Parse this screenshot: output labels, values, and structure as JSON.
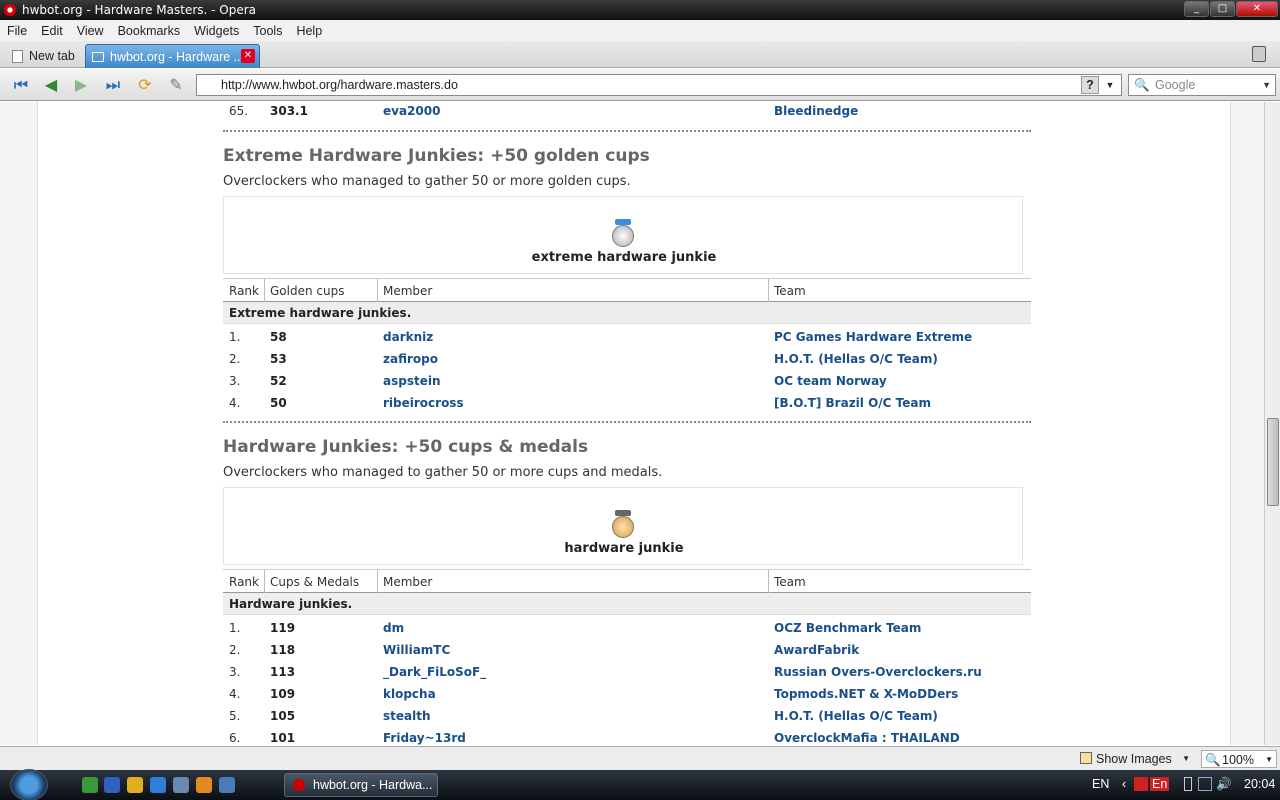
{
  "window": {
    "title": "hwbot.org - Hardware Masters. - Opera"
  },
  "menu": [
    "File",
    "Edit",
    "View",
    "Bookmarks",
    "Widgets",
    "Tools",
    "Help"
  ],
  "tabs": [
    {
      "label": "New tab"
    },
    {
      "label": "hwbot.org - Hardware ..."
    }
  ],
  "address": {
    "url": "http://www.hwbot.org/hardware.masters.do",
    "help": "?"
  },
  "search": {
    "placeholder": "Google"
  },
  "top_row": {
    "rank": "65.",
    "value": "303.1",
    "member": "eva2000",
    "team": "Bleedinedge"
  },
  "sections": [
    {
      "title": "Extreme Hardware Junkies: +50 golden cups",
      "desc": "Overclockers who managed to gather 50 or more golden cups.",
      "badge_label": "extreme hardware junkie",
      "badge_color": "#3a8fd6",
      "headers": [
        "Rank",
        "Golden cups",
        "Member",
        "Team"
      ],
      "group": "Extreme hardware junkies.",
      "rows": [
        {
          "rank": "1.",
          "value": "58",
          "member": "darkniz",
          "team": "PC Games Hardware Extreme"
        },
        {
          "rank": "2.",
          "value": "53",
          "member": "zafiropo",
          "team": "H.O.T. (Hellas O/C Team)"
        },
        {
          "rank": "3.",
          "value": "52",
          "member": "aspstein",
          "team": "OC team Norway"
        },
        {
          "rank": "4.",
          "value": "50",
          "member": "ribeirocross",
          "team": "[B.O.T] Brazil O/C Team"
        }
      ]
    },
    {
      "title": "Hardware Junkies: +50 cups & medals",
      "desc": "Overclockers who managed to gather 50 or more cups and medals.",
      "badge_label": "hardware junkie",
      "badge_color": "#666666",
      "headers": [
        "Rank",
        "Cups & Medals",
        "Member",
        "Team"
      ],
      "group": "Hardware junkies.",
      "rows": [
        {
          "rank": "1.",
          "value": "119",
          "member": "dm",
          "team": "OCZ Benchmark Team"
        },
        {
          "rank": "2.",
          "value": "118",
          "member": "WilliamTC",
          "team": "AwardFabrik"
        },
        {
          "rank": "3.",
          "value": "113",
          "member": "_Dark_FiLoSoF_",
          "team": "Russian Overs-Overclockers.ru"
        },
        {
          "rank": "4.",
          "value": "109",
          "member": "klopcha",
          "team": "Topmods.NET & X-MoDDers"
        },
        {
          "rank": "5.",
          "value": "105",
          "member": "stealth",
          "team": "H.O.T. (Hellas O/C Team)"
        },
        {
          "rank": "6.",
          "value": "101",
          "member": "Friday~13rd",
          "team": "OverclockMafia : THAILAND"
        }
      ]
    }
  ],
  "status": {
    "show_images": "Show Images",
    "zoom": "100%"
  },
  "taskbar": {
    "window_button": "hwbot.org - Hardwa...",
    "lang": "EN",
    "ime": "En",
    "time": "20:04"
  }
}
